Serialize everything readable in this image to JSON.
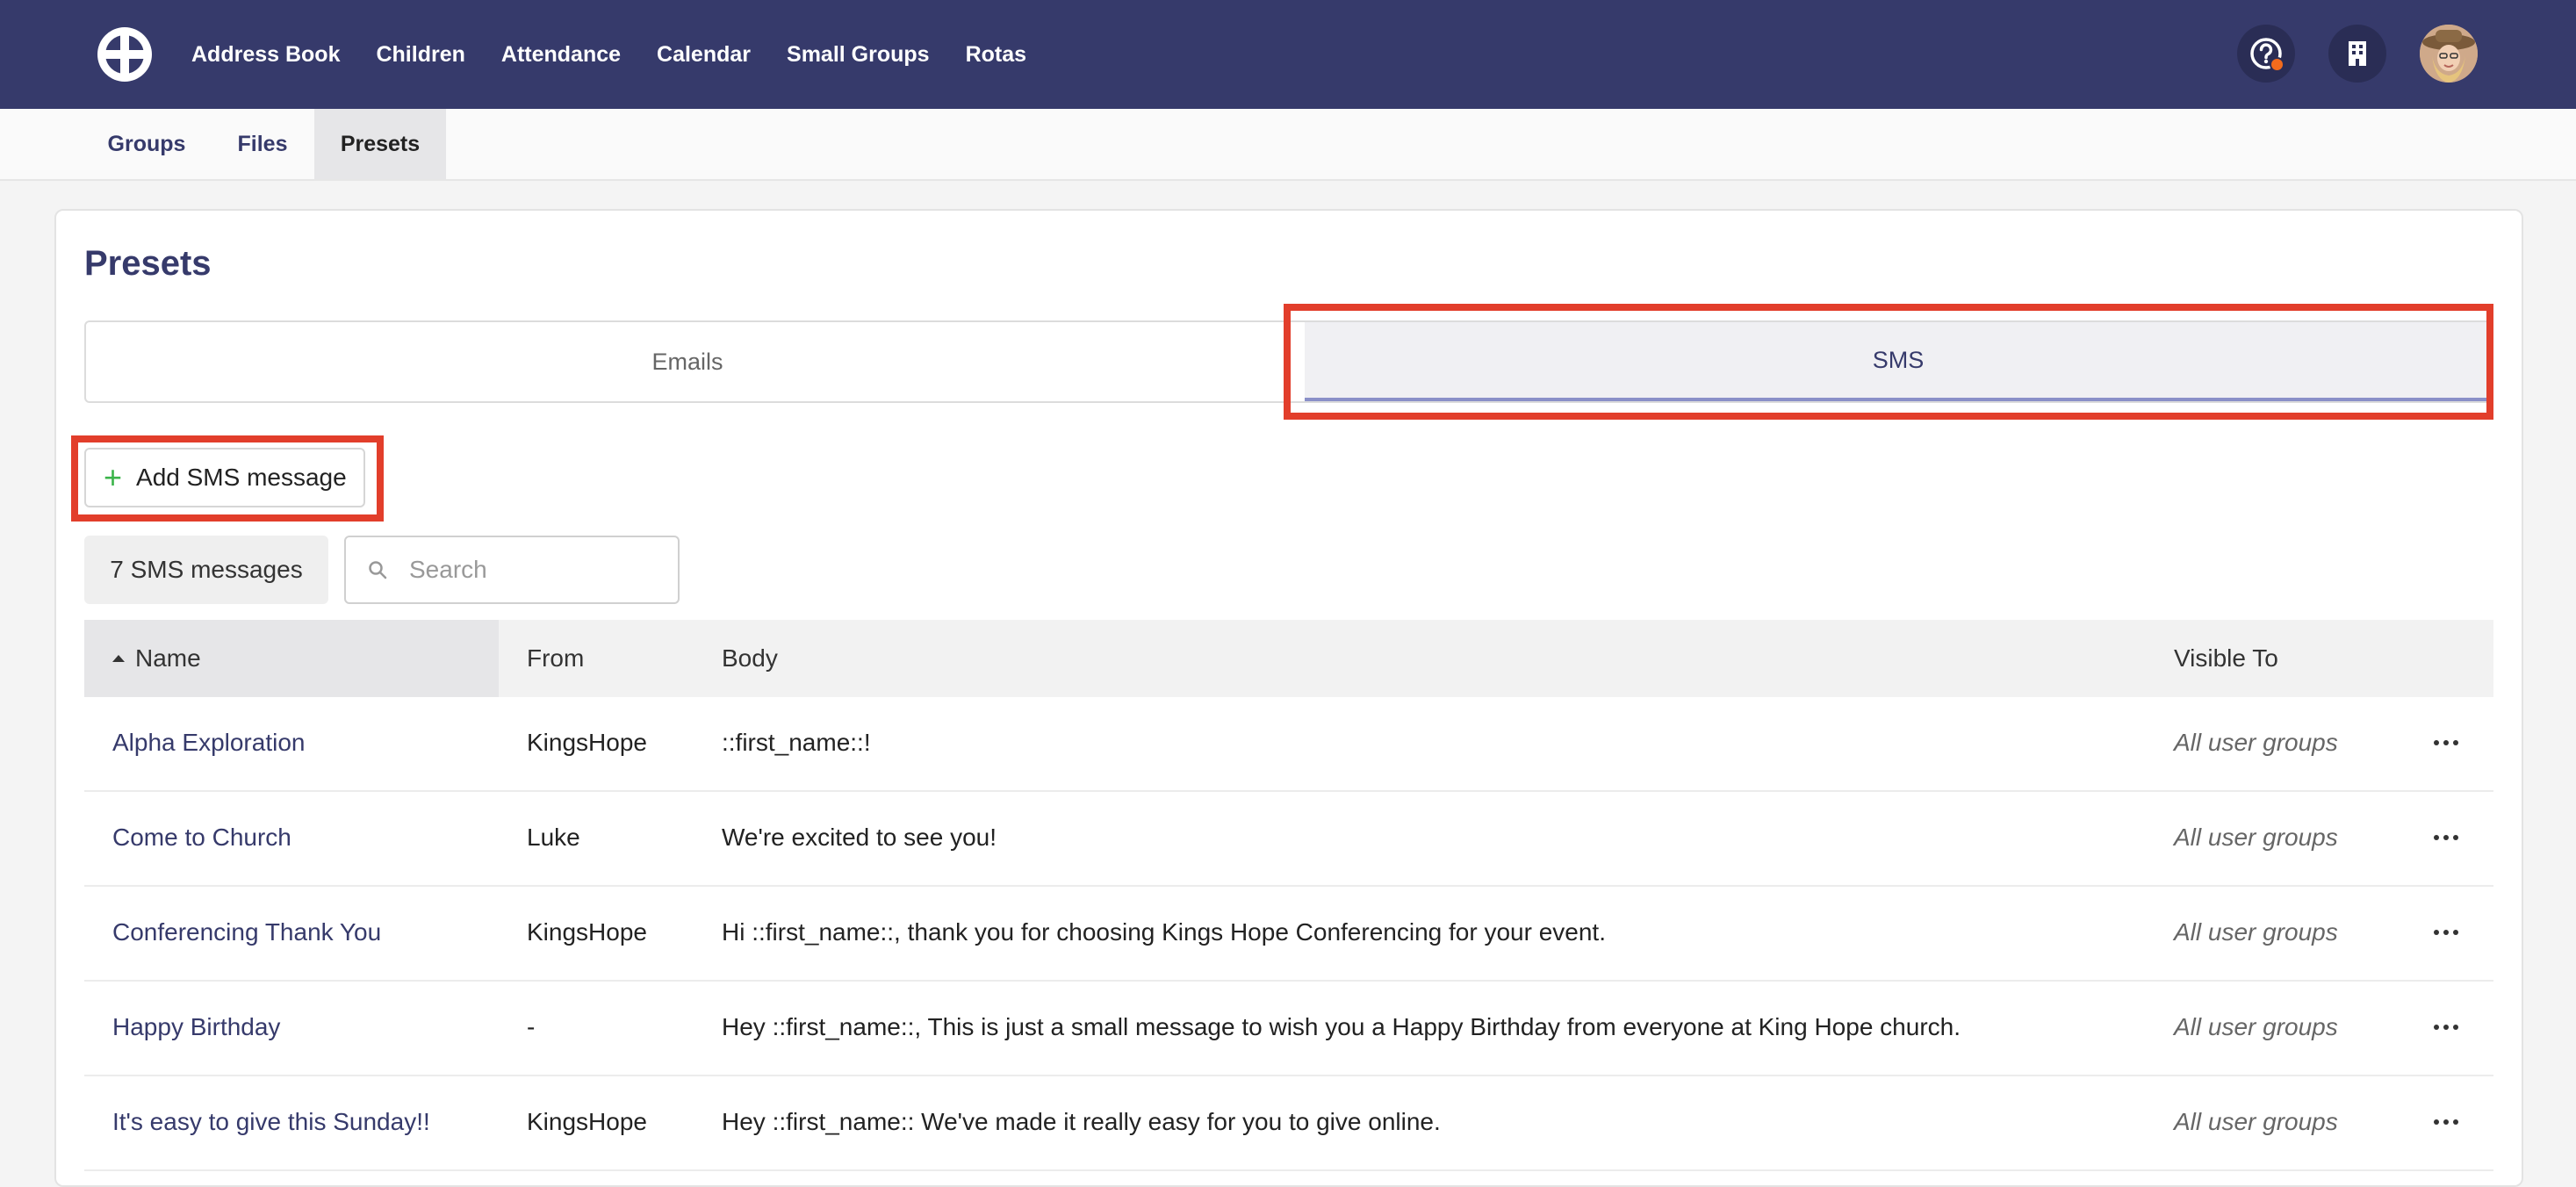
{
  "nav": {
    "links": [
      "Address Book",
      "Children",
      "Attendance",
      "Calendar",
      "Small Groups",
      "Rotas"
    ]
  },
  "subnav": {
    "tabs": [
      "Groups",
      "Files",
      "Presets"
    ],
    "active": "Presets"
  },
  "page": {
    "title": "Presets",
    "tabs": {
      "emails": "Emails",
      "sms": "SMS"
    },
    "active_tab": "SMS",
    "add_button": "Add SMS message",
    "count": "7 SMS messages",
    "search_placeholder": "Search"
  },
  "table": {
    "headers": {
      "name": "Name",
      "from": "From",
      "body": "Body",
      "visible": "Visible To"
    },
    "rows": [
      {
        "name": "Alpha Exploration",
        "from": "KingsHope",
        "body": "::first_name::!",
        "visible": "All user groups"
      },
      {
        "name": "Come to Church",
        "from": "Luke",
        "body": "We're excited to see you!",
        "visible": "All user groups"
      },
      {
        "name": "Conferencing Thank You",
        "from": "KingsHope",
        "body": "Hi ::first_name::, thank you for choosing Kings Hope Conferencing for your event.",
        "visible": "All user groups"
      },
      {
        "name": "Happy Birthday",
        "from": "-",
        "body": "Hey ::first_name::, This is just a small message to wish you a Happy Birthday from everyone at King Hope church.",
        "visible": "All user groups"
      },
      {
        "name": "It's easy to give this Sunday!!",
        "from": "KingsHope",
        "body": "Hey ::first_name:: We've made it really easy for you to give online.",
        "visible": "All user groups"
      }
    ]
  },
  "colors": {
    "navbar": "#363a6b",
    "accent_link": "#363a6b",
    "highlight": "#e23e2b",
    "plus": "#3bb44a"
  },
  "icons": [
    "app-logo-icon",
    "help-icon",
    "building-icon",
    "search-icon",
    "plus-icon",
    "more-icon",
    "sort-ascending-icon"
  ]
}
